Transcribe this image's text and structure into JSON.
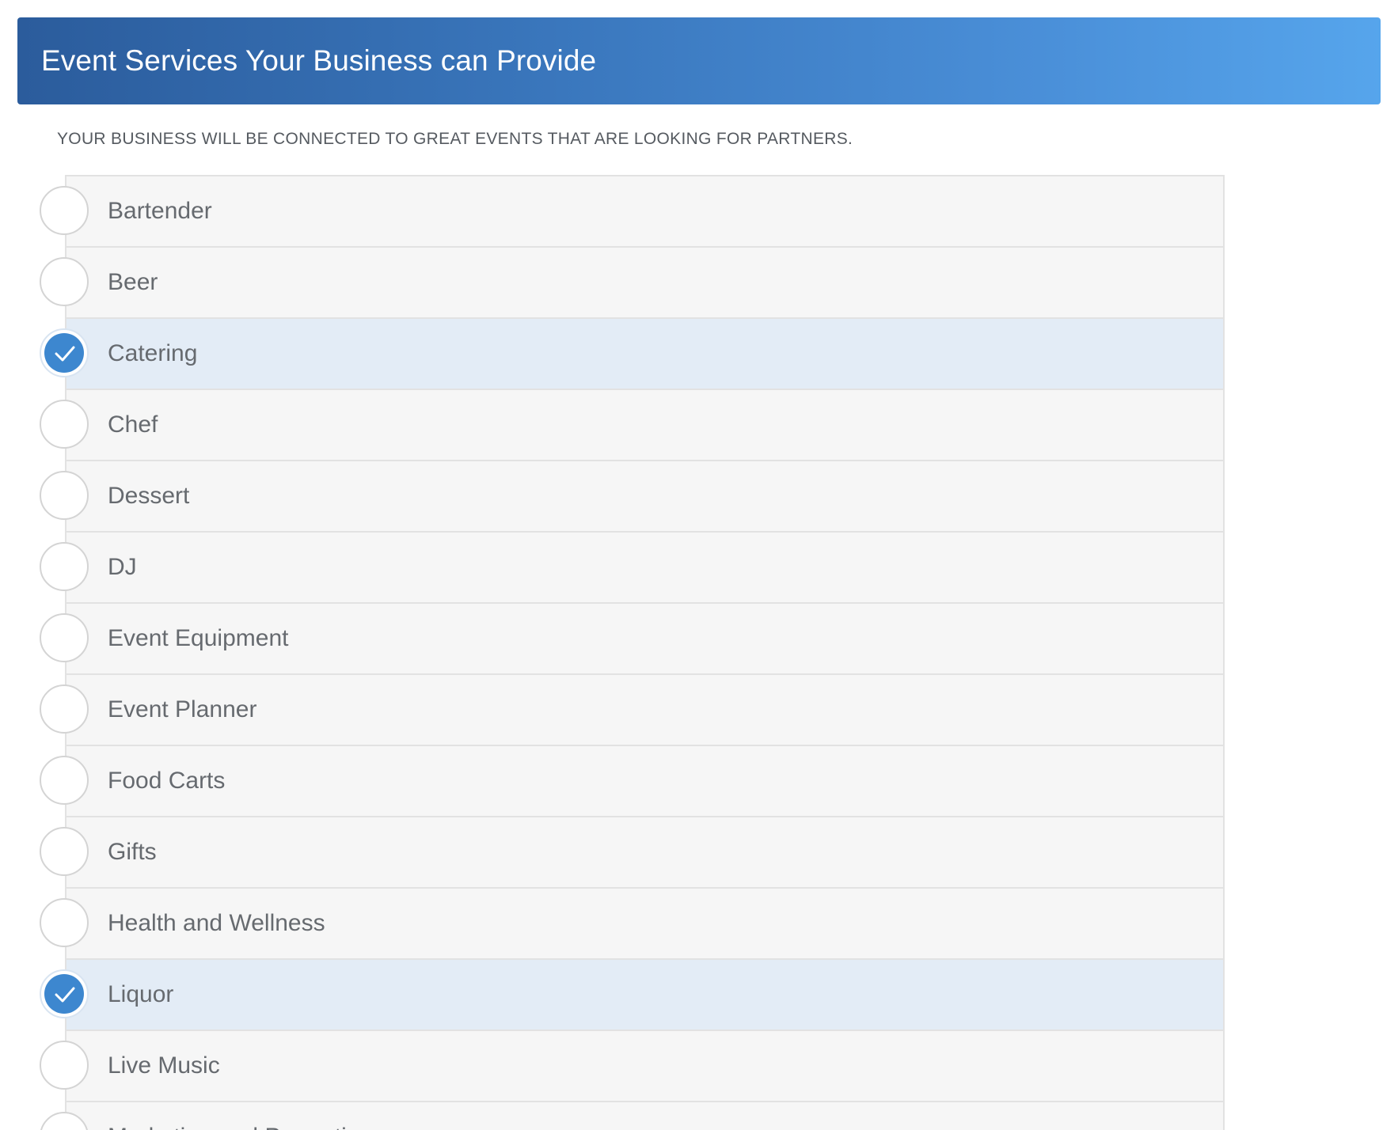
{
  "header": {
    "title": "Event Services Your Business can Provide"
  },
  "subtitle": "YOUR BUSINESS WILL BE CONNECTED TO GREAT EVENTS THAT ARE LOOKING FOR PARTNERS.",
  "colors": {
    "header_gradient_start": "#2b5c9c",
    "header_gradient_end": "#56a5ec",
    "checked_row_bg": "#e3ecf6",
    "checkmark_fill": "#3d87cf",
    "row_bg": "#f6f6f6",
    "label_text": "#666a6f"
  },
  "services": [
    {
      "label": "Bartender",
      "checked": false
    },
    {
      "label": "Beer",
      "checked": false
    },
    {
      "label": "Catering",
      "checked": true
    },
    {
      "label": "Chef",
      "checked": false
    },
    {
      "label": "Dessert",
      "checked": false
    },
    {
      "label": "DJ",
      "checked": false
    },
    {
      "label": "Event Equipment",
      "checked": false
    },
    {
      "label": "Event Planner",
      "checked": false
    },
    {
      "label": "Food Carts",
      "checked": false
    },
    {
      "label": "Gifts",
      "checked": false
    },
    {
      "label": "Health and Wellness",
      "checked": false
    },
    {
      "label": "Liquor",
      "checked": true
    },
    {
      "label": "Live Music",
      "checked": false
    },
    {
      "label": "Marketing and Promotion",
      "checked": false
    }
  ]
}
